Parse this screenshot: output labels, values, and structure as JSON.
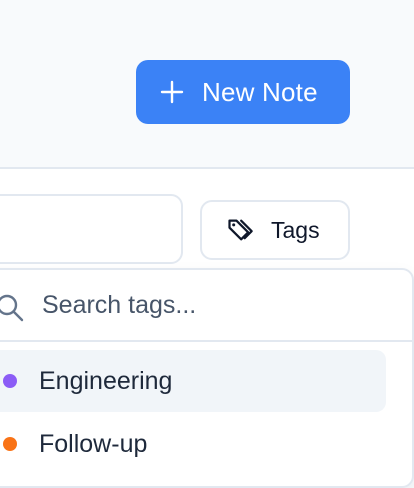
{
  "header": {
    "new_note_label": "New Note"
  },
  "filter": {
    "tags_button_label": "Tags"
  },
  "tag_dropdown": {
    "search_placeholder": "Search tags...",
    "items": [
      {
        "label": "Engineering",
        "color": "#8b5cf6",
        "highlighted": true
      },
      {
        "label": "Follow-up",
        "color": "#f97316",
        "highlighted": false
      }
    ]
  },
  "colors": {
    "accent": "#3b82f6",
    "border": "#e2e8f0",
    "hover": "#f1f5f9"
  },
  "icons": {
    "new_note": "plus-icon",
    "tags": "tag-icon",
    "dropdown_search": "search-icon"
  }
}
